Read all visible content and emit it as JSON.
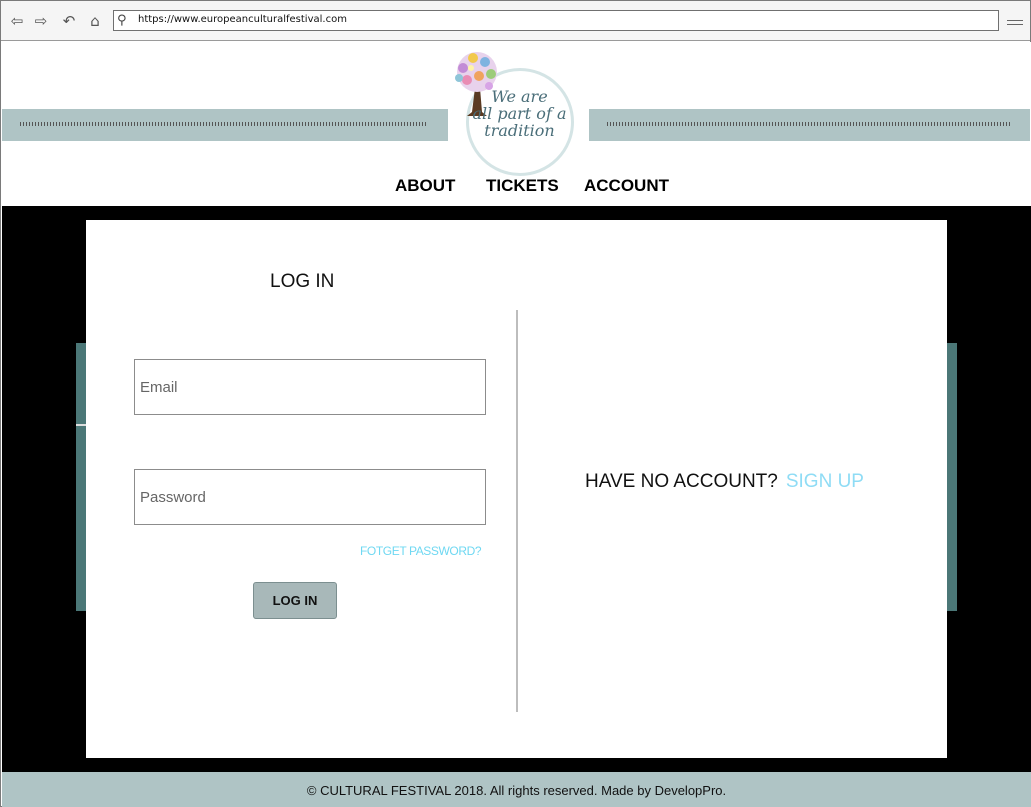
{
  "browser": {
    "url": "https://www.europeanculturalfestival.com",
    "icons": [
      "back-icon",
      "forward-icon",
      "refresh-icon",
      "home-icon",
      "search-icon",
      "menu-icon"
    ]
  },
  "header": {
    "logo_lines": [
      "We are",
      "all part of a",
      "tradition"
    ],
    "nav": [
      "ABOUT",
      "TICKETS",
      "ACCOUNT"
    ],
    "strip_color": "#afc4c5"
  },
  "login": {
    "title": "LOG IN",
    "email_placeholder": "Email",
    "password_placeholder": "Password",
    "forgot_label": "FOTGET PASSWORD?",
    "button_label": "LOG IN"
  },
  "signup": {
    "prompt": "HAVE NO ACCOUNT?",
    "link_label": "SIGN UP",
    "link_color": "#8fdcf5"
  },
  "footer": {
    "text": "© CULTURAL FESTIVAL 2018. All rights reserved. Made by DevelopPro."
  }
}
